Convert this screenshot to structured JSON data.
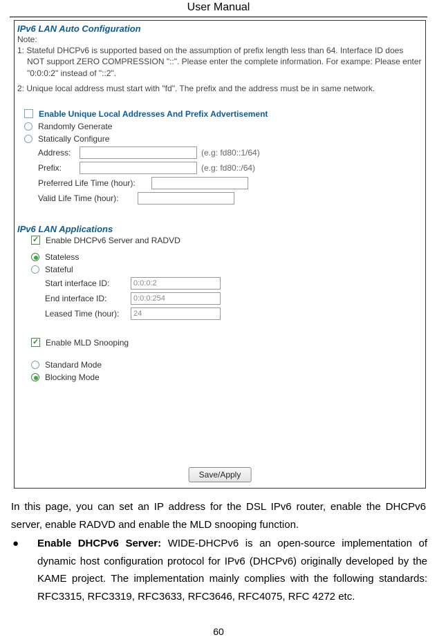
{
  "header": "User Manual",
  "pageNumber": "60",
  "ui": {
    "section1_title": "IPv6 LAN Auto Configuration",
    "note_label": "Note:",
    "note1": "1: Stateful DHCPv6 is supported based on the assumption of prefix length less than 64. Interface ID does NOT support ZERO COMPRESSION \"::\". Please enter the complete information. For exampe: Please enter \"0:0:0:2\" instead of \"::2\".",
    "note2": "2: Unique local address must start with \"fd\". The prefix and the address must be in same network.",
    "chk_ula_label": "Enable Unique Local Addresses And Prefix Advertisement",
    "radio_random": "Randomly Generate",
    "radio_static": "Statically Configure",
    "addr_label": "Address:",
    "addr_hint": "(e.g: fd80::1/64)",
    "prefix_label": "Prefix:",
    "prefix_hint": "(e.g: fd80::/64)",
    "pref_life_label": "Preferred Life Time (hour):",
    "valid_life_label": "Valid Life Time (hour):",
    "section2_title": "IPv6 LAN Applications",
    "chk_dhcpv6_label": "Enable DHCPv6 Server and RADVD",
    "radio_stateless": "Stateless",
    "radio_stateful": "Stateful",
    "start_id_label": "Start interface ID:",
    "start_id_value": "0:0:0:2",
    "end_id_label": "End interface ID:",
    "end_id_value": "0:0:0:254",
    "leased_label": "Leased Time (hour):",
    "leased_value": "24",
    "chk_mld_label": "Enable MLD Snooping",
    "radio_standard": "Standard Mode",
    "radio_blocking": "Blocking Mode",
    "save_btn": "Save/Apply"
  },
  "body": {
    "para1": "In this page, you can set an IP address for the DSL IPv6 router, enable the DHCPv6 server, enable RADVD and enable the MLD snooping function.",
    "bullet1_title": "Enable DHCPv6 Server: ",
    "bullet1_body": "WIDE-DHCPv6 is an open-source implementation of dynamic host configuration protocol for IPv6 (DHCPv6) originally developed by the KAME project. The implementation mainly complies with the following standards: RFC3315, RFC3319, RFC3633, RFC3646, RFC4075, RFC 4272 etc."
  }
}
